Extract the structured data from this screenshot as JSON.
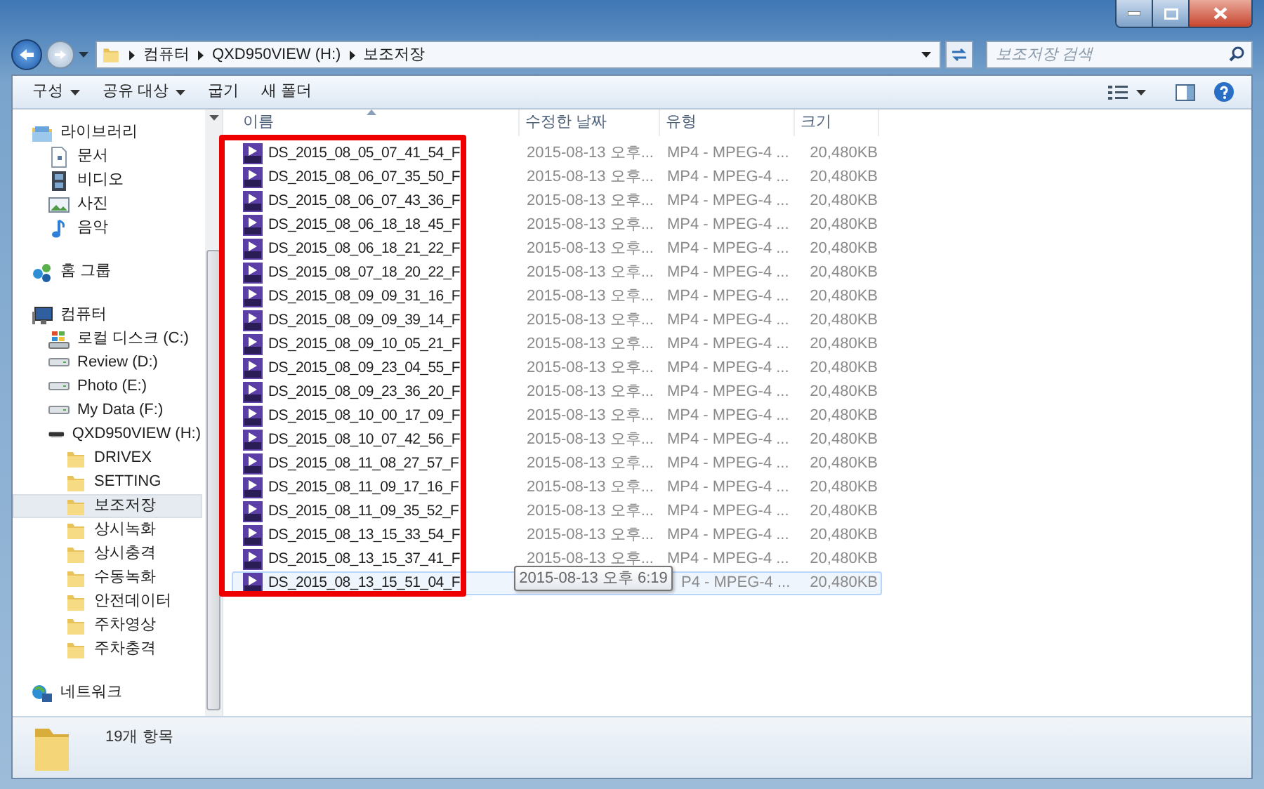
{
  "address": {
    "breadcrumb": [
      "컴퓨터",
      "QXD950VIEW (H:)",
      "보조저장"
    ]
  },
  "search": {
    "placeholder": "보조저장 검색"
  },
  "toolbar": {
    "items": [
      {
        "label": "구성",
        "dropdown": true
      },
      {
        "label": "공유 대상",
        "dropdown": true
      },
      {
        "label": "굽기",
        "dropdown": false
      },
      {
        "label": "새 폴더",
        "dropdown": false
      }
    ]
  },
  "sidebar": {
    "groups": [
      {
        "label": "라이브러리",
        "kind": "library",
        "selected": false,
        "children": [
          {
            "label": "문서",
            "kind": "document",
            "selected": false
          },
          {
            "label": "비디오",
            "kind": "video",
            "selected": false
          },
          {
            "label": "사진",
            "kind": "picture",
            "selected": false
          },
          {
            "label": "음악",
            "kind": "music",
            "selected": false
          }
        ]
      },
      {
        "label": "홈 그룹",
        "kind": "homegroup",
        "selected": false
      },
      {
        "label": "컴퓨터",
        "kind": "computer",
        "selected": false,
        "children": [
          {
            "label": "로컬 디스크 (C:)",
            "kind": "system-drive",
            "selected": false
          },
          {
            "label": "Review (D:)",
            "kind": "drive",
            "selected": false
          },
          {
            "label": "Photo (E:)",
            "kind": "drive",
            "selected": false
          },
          {
            "label": "My Data (F:)",
            "kind": "drive",
            "selected": false
          },
          {
            "label": "QXD950VIEW (H:)",
            "kind": "removable",
            "selected": false,
            "children": [
              {
                "label": "DRIVEX",
                "kind": "folder",
                "selected": false
              },
              {
                "label": "SETTING",
                "kind": "folder",
                "selected": false
              },
              {
                "label": "보조저장",
                "kind": "folder",
                "selected": true
              },
              {
                "label": "상시녹화",
                "kind": "folder",
                "selected": false
              },
              {
                "label": "상시충격",
                "kind": "folder",
                "selected": false
              },
              {
                "label": "수동녹화",
                "kind": "folder",
                "selected": false
              },
              {
                "label": "안전데이터",
                "kind": "folder",
                "selected": false
              },
              {
                "label": "주차영상",
                "kind": "folder",
                "selected": false
              },
              {
                "label": "주차충격",
                "kind": "folder",
                "selected": false
              }
            ]
          }
        ]
      },
      {
        "label": "네트워크",
        "kind": "network",
        "selected": false
      }
    ]
  },
  "table": {
    "columns": [
      {
        "label": "이름",
        "sorted": true
      },
      {
        "label": "수정한 날짜",
        "sorted": false
      },
      {
        "label": "유형",
        "sorted": false
      },
      {
        "label": "크기",
        "sorted": false
      }
    ],
    "rows": [
      {
        "name": "DS_2015_08_05_07_41_54_F",
        "date": "2015-08-13 오후...",
        "type": "MP4 - MPEG-4 ...",
        "size": "20,480KB",
        "hovered": false
      },
      {
        "name": "DS_2015_08_06_07_35_50_F",
        "date": "2015-08-13 오후...",
        "type": "MP4 - MPEG-4 ...",
        "size": "20,480KB",
        "hovered": false
      },
      {
        "name": "DS_2015_08_06_07_43_36_F",
        "date": "2015-08-13 오후...",
        "type": "MP4 - MPEG-4 ...",
        "size": "20,480KB",
        "hovered": false
      },
      {
        "name": "DS_2015_08_06_18_18_45_F",
        "date": "2015-08-13 오후...",
        "type": "MP4 - MPEG-4 ...",
        "size": "20,480KB",
        "hovered": false
      },
      {
        "name": "DS_2015_08_06_18_21_22_F",
        "date": "2015-08-13 오후...",
        "type": "MP4 - MPEG-4 ...",
        "size": "20,480KB",
        "hovered": false
      },
      {
        "name": "DS_2015_08_07_18_20_22_F",
        "date": "2015-08-13 오후...",
        "type": "MP4 - MPEG-4 ...",
        "size": "20,480KB",
        "hovered": false
      },
      {
        "name": "DS_2015_08_09_09_31_16_F",
        "date": "2015-08-13 오후...",
        "type": "MP4 - MPEG-4 ...",
        "size": "20,480KB",
        "hovered": false
      },
      {
        "name": "DS_2015_08_09_09_39_14_F",
        "date": "2015-08-13 오후...",
        "type": "MP4 - MPEG-4 ...",
        "size": "20,480KB",
        "hovered": false
      },
      {
        "name": "DS_2015_08_09_10_05_21_F",
        "date": "2015-08-13 오후...",
        "type": "MP4 - MPEG-4 ...",
        "size": "20,480KB",
        "hovered": false
      },
      {
        "name": "DS_2015_08_09_23_04_55_F",
        "date": "2015-08-13 오후...",
        "type": "MP4 - MPEG-4 ...",
        "size": "20,480KB",
        "hovered": false
      },
      {
        "name": "DS_2015_08_09_23_36_20_F",
        "date": "2015-08-13 오후...",
        "type": "MP4 - MPEG-4 ...",
        "size": "20,480KB",
        "hovered": false
      },
      {
        "name": "DS_2015_08_10_00_17_09_F",
        "date": "2015-08-13 오후...",
        "type": "MP4 - MPEG-4 ...",
        "size": "20,480KB",
        "hovered": false
      },
      {
        "name": "DS_2015_08_10_07_42_56_F",
        "date": "2015-08-13 오후...",
        "type": "MP4 - MPEG-4 ...",
        "size": "20,480KB",
        "hovered": false
      },
      {
        "name": "DS_2015_08_11_08_27_57_F",
        "date": "2015-08-13 오후...",
        "type": "MP4 - MPEG-4 ...",
        "size": "20,480KB",
        "hovered": false
      },
      {
        "name": "DS_2015_08_11_09_17_16_F",
        "date": "2015-08-13 오후...",
        "type": "MP4 - MPEG-4 ...",
        "size": "20,480KB",
        "hovered": false
      },
      {
        "name": "DS_2015_08_11_09_35_52_F",
        "date": "2015-08-13 오후...",
        "type": "MP4 - MPEG-4 ...",
        "size": "20,480KB",
        "hovered": false
      },
      {
        "name": "DS_2015_08_13_15_33_54_F",
        "date": "2015-08-13 오후...",
        "type": "MP4 - MPEG-4 ...",
        "size": "20,480KB",
        "hovered": false
      },
      {
        "name": "DS_2015_08_13_15_37_41_F",
        "date": "2015-08-13 오후...",
        "type": "MP4 - MPEG-4 ...",
        "size": "20,480KB",
        "hovered": false
      },
      {
        "name": "DS_2015_08_13_15_51_04_F",
        "type": "P4 - MPEG-4 ...",
        "size": "20,480KB",
        "hovered": true
      }
    ]
  },
  "tooltip": {
    "text": "2015-08-13 오후 6:19"
  },
  "status_bar": {
    "count": "19개 항목"
  }
}
